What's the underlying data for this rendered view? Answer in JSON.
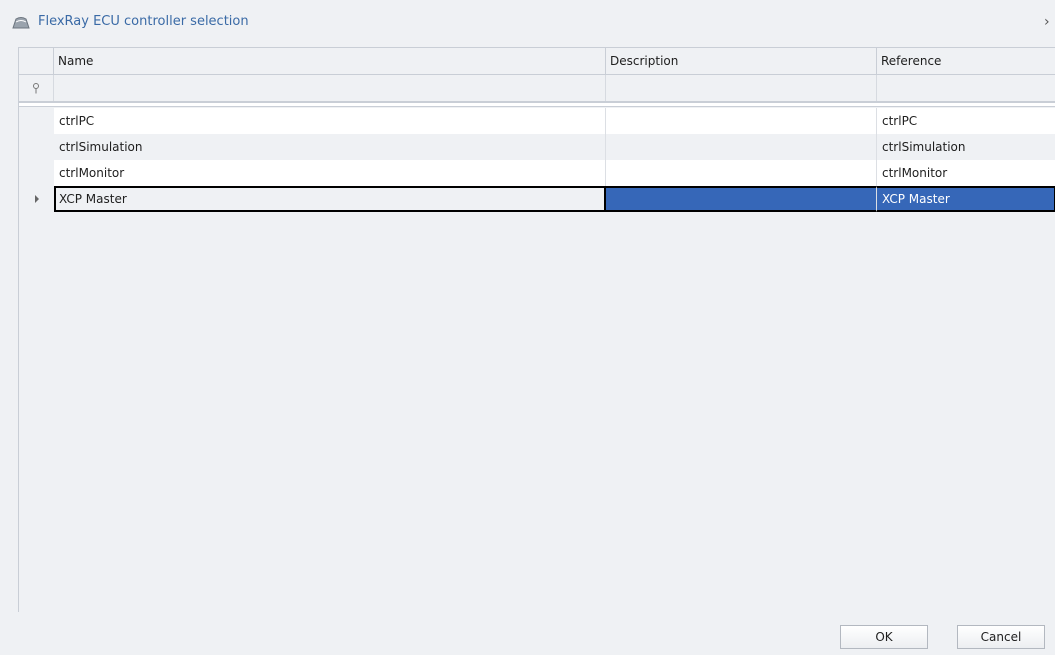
{
  "dialog": {
    "title": "FlexRay ECU controller selection",
    "close_glyph": "›"
  },
  "grid": {
    "columns": [
      {
        "label": "Name"
      },
      {
        "label": "Description"
      },
      {
        "label": "Reference"
      }
    ],
    "filter_icon": "pin-icon",
    "rows": [
      {
        "name": "ctrlPC",
        "description": "",
        "reference": "ctrlPC"
      },
      {
        "name": "ctrlSimulation",
        "description": "",
        "reference": "ctrlSimulation"
      },
      {
        "name": "ctrlMonitor",
        "description": "",
        "reference": "ctrlMonitor"
      },
      {
        "name": "XCP Master",
        "description": "",
        "reference": "XCP Master",
        "focused": true
      }
    ]
  },
  "footer": {
    "ok_label": "OK",
    "cancel_label": "Cancel"
  },
  "colors": {
    "accent_title": "#3a6aa6",
    "selection": "#3667b8",
    "background": "#eff1f4"
  }
}
